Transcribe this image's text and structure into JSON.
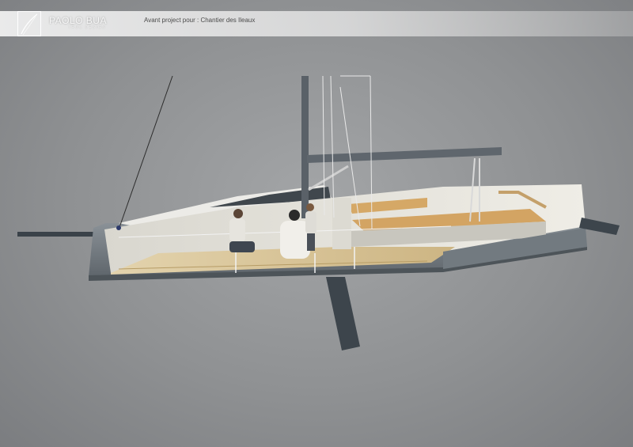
{
  "header": {
    "brand_name": "PAOLO BUA",
    "brand_subtitle": "TRUC DESIGN",
    "caption": "Avant project  pour : Chantier des Ileaux"
  },
  "icons": {
    "logo": "logo-mark-icon"
  },
  "colors": {
    "background": "#8f9193",
    "hull_grey": "#6e757b",
    "deck_wood": "#d8c49a",
    "appendage": "#3d454c"
  }
}
